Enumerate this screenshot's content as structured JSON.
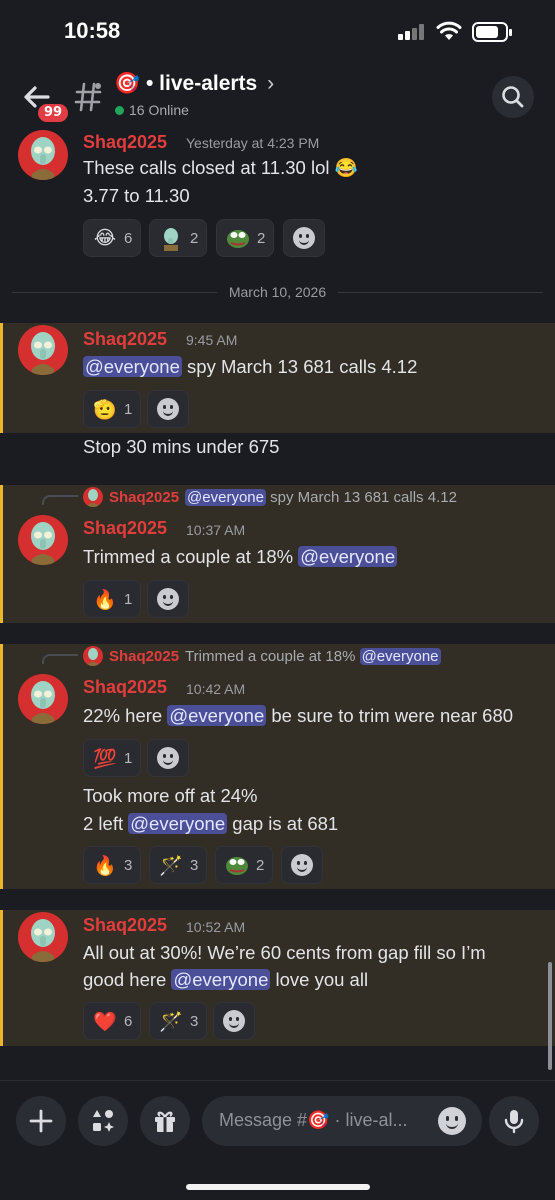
{
  "status": {
    "time": "10:58"
  },
  "header": {
    "badge": "99",
    "channel_name": "🎯 • live-alerts",
    "chevron": "›",
    "online": "16 Online"
  },
  "messages": [
    {
      "author": "Shaq2025",
      "timestamp": "Yesterday at 4:23 PM",
      "lines": [
        "These calls closed at 11.30 lol 😂",
        "3.77 to 11.30"
      ],
      "reactions": [
        {
          "emoji": "😂",
          "count": "6"
        },
        {
          "emoji": "squidward-sticker",
          "count": "2"
        },
        {
          "emoji": "pepe-sticker",
          "count": "2"
        }
      ]
    },
    {
      "date_divider": "March 10, 2026"
    },
    {
      "author": "Shaq2025",
      "timestamp": "9:45 AM",
      "mention": "@everyone",
      "text_after_mention": " spy March 13 681 calls 4.12",
      "reactions": [
        {
          "emoji": "🫡",
          "count": "1"
        }
      ],
      "followup": "Stop 30 mins under 675"
    },
    {
      "reply_author": "Shaq2025",
      "reply_mention": "@everyone",
      "reply_text": " spy March 13 681 calls 4.12",
      "author": "Shaq2025",
      "timestamp": "10:37 AM",
      "text_before_mention": "Trimmed a couple at 18% ",
      "mention": "@everyone",
      "reactions": [
        {
          "emoji": "🔥",
          "count": "1"
        }
      ]
    },
    {
      "reply_author": "Shaq2025",
      "reply_text": "Trimmed a couple at 18% ",
      "reply_mention": "@everyone",
      "author": "Shaq2025",
      "timestamp": "10:42 AM",
      "text_before_mention": "22% here ",
      "mention": "@everyone",
      "text_after_mention": " be sure to trim were near 680",
      "reactions": [
        {
          "emoji": "💯",
          "count": "1"
        }
      ],
      "followup1": "Took more off at 24%",
      "followup2_before": "2 left ",
      "followup2_mention": "@everyone",
      "followup2_after": " gap is at 681",
      "reactions2": [
        {
          "emoji": "🔥",
          "count": "3"
        },
        {
          "emoji": "🪄",
          "count": "3"
        },
        {
          "emoji": "pepe-sticker",
          "count": "2"
        }
      ]
    },
    {
      "author": "Shaq2025",
      "timestamp": "10:52 AM",
      "line1": "All out at 30%! We’re 60 cents from gap fill so I’m",
      "line2_before": "good here ",
      "mention": "@everyone",
      "line2_after": " love you all",
      "reactions": [
        {
          "emoji": "❤️",
          "count": "6"
        },
        {
          "emoji": "🪄",
          "count": "3"
        }
      ]
    }
  ],
  "composer": {
    "placeholder": "Message #🎯 · live-al..."
  },
  "colors": {
    "author": "#e23d3d",
    "mention_bg": "#4b4f98",
    "highlight_bg": "#322e25",
    "highlight_bar": "#efb52a"
  }
}
